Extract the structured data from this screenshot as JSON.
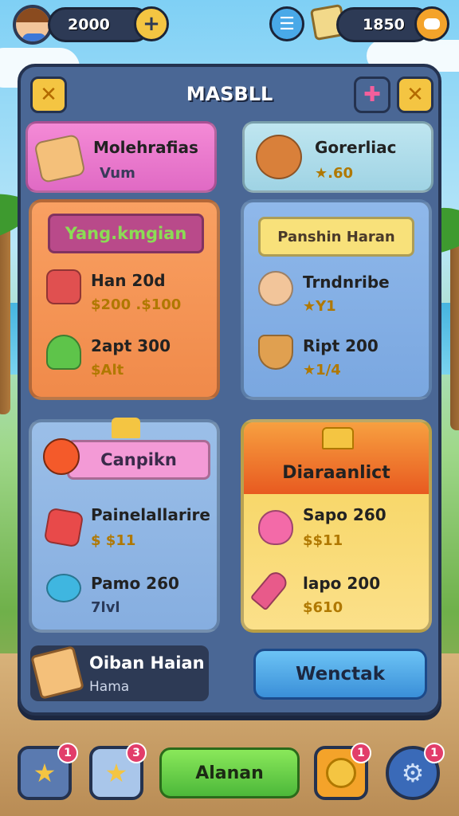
{
  "top_bar": {
    "coins": "2000",
    "gems": "1850",
    "plus_symbol": "+",
    "menu_symbol": "☰"
  },
  "panel": {
    "title": "MASBLL",
    "close_symbol": "✕",
    "plus_symbol": "✚",
    "second_symbol": "✕"
  },
  "small_cards": [
    {
      "title": "Molehrafias",
      "subtitle": "Vum",
      "icon": "tablet-icon"
    },
    {
      "title": "Gorerliac",
      "subtitle": "★.60",
      "icon": "bowl-icon"
    }
  ],
  "cards": [
    {
      "banner": "Yang.kmgian",
      "items": [
        {
          "name": "Han 20d",
          "price": "$200 .$100",
          "icon": "paint-roller-icon"
        },
        {
          "name": "2apt 300",
          "price": "$Alt",
          "icon": "green-tool-icon"
        }
      ]
    },
    {
      "banner": "Panshin Haran",
      "items": [
        {
          "name": "Trndnribe",
          "price": "★Y1",
          "icon": "character-icon"
        },
        {
          "name": "Ript 200",
          "price": "★1/4",
          "icon": "cake-basket-icon"
        }
      ]
    },
    {
      "banner": "Canpikn",
      "items": [
        {
          "name": "Painelallarire",
          "price": "$ $11",
          "icon": "red-gem-icon"
        },
        {
          "name": "Pamo 260",
          "price": "7lvl",
          "icon": "blue-gem-icon"
        }
      ]
    },
    {
      "banner": "Diaraanlict",
      "items": [
        {
          "name": "Sapo 260",
          "price": "$$11",
          "icon": "pink-bowl-icon"
        },
        {
          "name": "lapo 200",
          "price": "$610",
          "icon": "popsicle-icon"
        }
      ]
    }
  ],
  "footer": {
    "promo_title": "Oiban Haian",
    "promo_subtitle": "Hama",
    "action_button": "Wenctak"
  },
  "bottom_bar": {
    "center_label": "Alanan",
    "badges": [
      "1",
      "3",
      "1",
      "1"
    ]
  },
  "colors": {
    "panel": "#4a6795",
    "gold": "#f4c542",
    "green_button": "#6fd34a",
    "blue_button": "#49a9e8"
  }
}
